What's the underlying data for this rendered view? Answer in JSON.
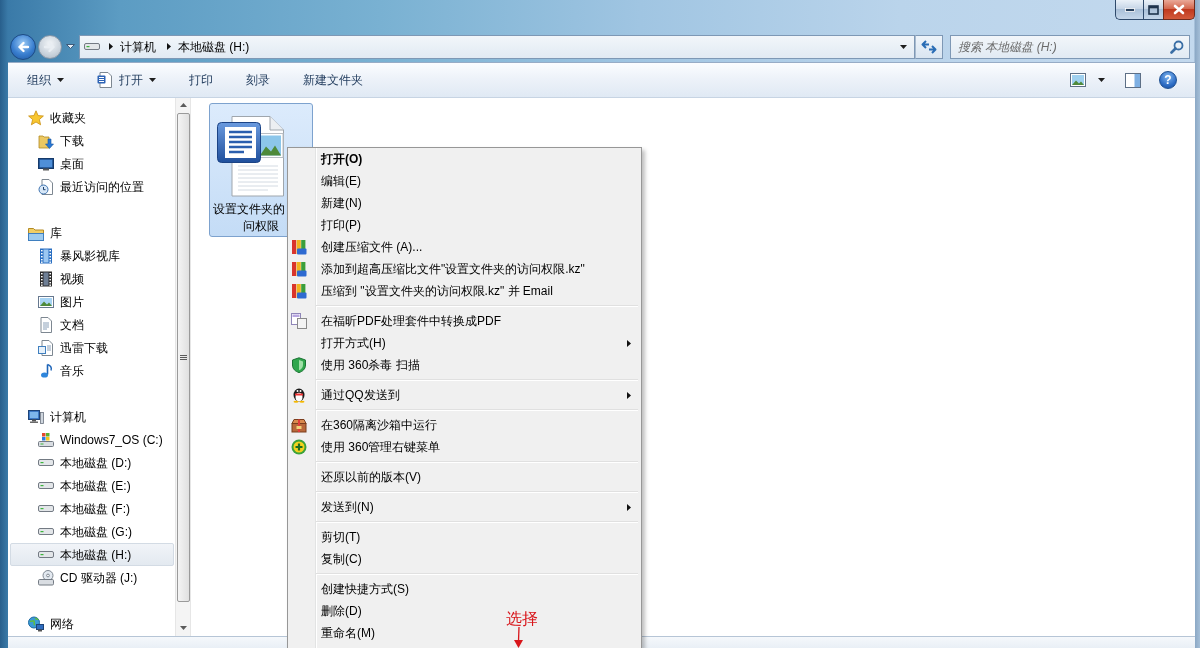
{
  "navigation": {
    "back": {
      "disabled": false
    },
    "forward": {
      "disabled": true
    }
  },
  "address_bar": {
    "path": [
      "计算机",
      "本地磁盘 (H:)"
    ]
  },
  "search": {
    "placeholder": "搜索 本地磁盘 (H:)"
  },
  "toolbar": {
    "buttons": [
      {
        "label": "组织",
        "dropdown": true
      },
      {
        "label": "打开",
        "dropdown": true
      },
      {
        "label": "打印",
        "dropdown": false
      },
      {
        "label": "刻录",
        "dropdown": false
      },
      {
        "label": "新建文件夹",
        "dropdown": false
      }
    ],
    "help": "?"
  },
  "sidebar": {
    "sections": [
      {
        "label": "收藏夹",
        "selected": false,
        "children": [
          {
            "label": "下载",
            "selected": false
          },
          {
            "label": "桌面",
            "selected": false
          },
          {
            "label": "最近访问的位置",
            "selected": false
          }
        ]
      },
      {
        "label": "库",
        "selected": false,
        "children": [
          {
            "label": "暴风影视库",
            "selected": false
          },
          {
            "label": "视频",
            "selected": false
          },
          {
            "label": "图片",
            "selected": false
          },
          {
            "label": "文档",
            "selected": false
          },
          {
            "label": "迅雷下载",
            "selected": false
          },
          {
            "label": "音乐",
            "selected": false
          }
        ]
      },
      {
        "label": "计算机",
        "selected": false,
        "children": [
          {
            "label": "Windows7_OS (C:)",
            "selected": false
          },
          {
            "label": "本地磁盘 (D:)",
            "selected": false
          },
          {
            "label": "本地磁盘 (E:)",
            "selected": false
          },
          {
            "label": "本地磁盘 (F:)",
            "selected": false
          },
          {
            "label": "本地磁盘 (G:)",
            "selected": false
          },
          {
            "label": "本地磁盘 (H:)",
            "selected": true
          },
          {
            "label": "CD 驱动器 (J:)",
            "selected": false
          }
        ]
      },
      {
        "label": "网络",
        "selected": false
      }
    ]
  },
  "files": [
    {
      "label_lines": [
        "设置文件夹的",
        "问权限"
      ],
      "selected": true
    }
  ],
  "context_menu": {
    "items": [
      {
        "kind": "command",
        "label": "打开(O)",
        "default": true,
        "submenu": false
      },
      {
        "kind": "command",
        "label": "编辑(E)",
        "default": false,
        "submenu": false
      },
      {
        "kind": "command",
        "label": "新建(N)",
        "default": false,
        "submenu": false
      },
      {
        "kind": "command",
        "label": "打印(P)",
        "default": false,
        "submenu": false
      },
      {
        "kind": "command",
        "label": "创建压缩文件 (A)...",
        "default": false,
        "submenu": false
      },
      {
        "kind": "command",
        "label": "添加到超高压缩比文件\"设置文件夹的访问权限.kz\"",
        "default": false,
        "submenu": false
      },
      {
        "kind": "command",
        "label": "压缩到 \"设置文件夹的访问权限.kz\" 并 Email",
        "default": false,
        "submenu": false
      },
      {
        "kind": "separator"
      },
      {
        "kind": "command",
        "label": "在福昕PDF处理套件中转换成PDF",
        "default": false,
        "submenu": false
      },
      {
        "kind": "command",
        "label": "打开方式(H)",
        "default": false,
        "submenu": true
      },
      {
        "kind": "command",
        "label": "使用 360杀毒 扫描",
        "default": false,
        "submenu": false
      },
      {
        "kind": "separator"
      },
      {
        "kind": "command",
        "label": "通过QQ发送到",
        "default": false,
        "submenu": true
      },
      {
        "kind": "separator"
      },
      {
        "kind": "command",
        "label": "在360隔离沙箱中运行",
        "default": false,
        "submenu": false
      },
      {
        "kind": "command",
        "label": "使用 360管理右键菜单",
        "default": false,
        "submenu": false
      },
      {
        "kind": "separator"
      },
      {
        "kind": "command",
        "label": "还原以前的版本(V)",
        "default": false,
        "submenu": false
      },
      {
        "kind": "separator"
      },
      {
        "kind": "command",
        "label": "发送到(N)",
        "default": false,
        "submenu": true
      },
      {
        "kind": "separator"
      },
      {
        "kind": "command",
        "label": "剪切(T)",
        "default": false,
        "submenu": false
      },
      {
        "kind": "command",
        "label": "复制(C)",
        "default": false,
        "submenu": false
      },
      {
        "kind": "separator"
      },
      {
        "kind": "command",
        "label": "创建快捷方式(S)",
        "default": false,
        "submenu": false
      },
      {
        "kind": "command",
        "label": "删除(D)",
        "default": false,
        "submenu": false
      },
      {
        "kind": "command",
        "label": "重命名(M)",
        "default": false,
        "submenu": false
      }
    ]
  },
  "annotation": {
    "text": "选择"
  }
}
